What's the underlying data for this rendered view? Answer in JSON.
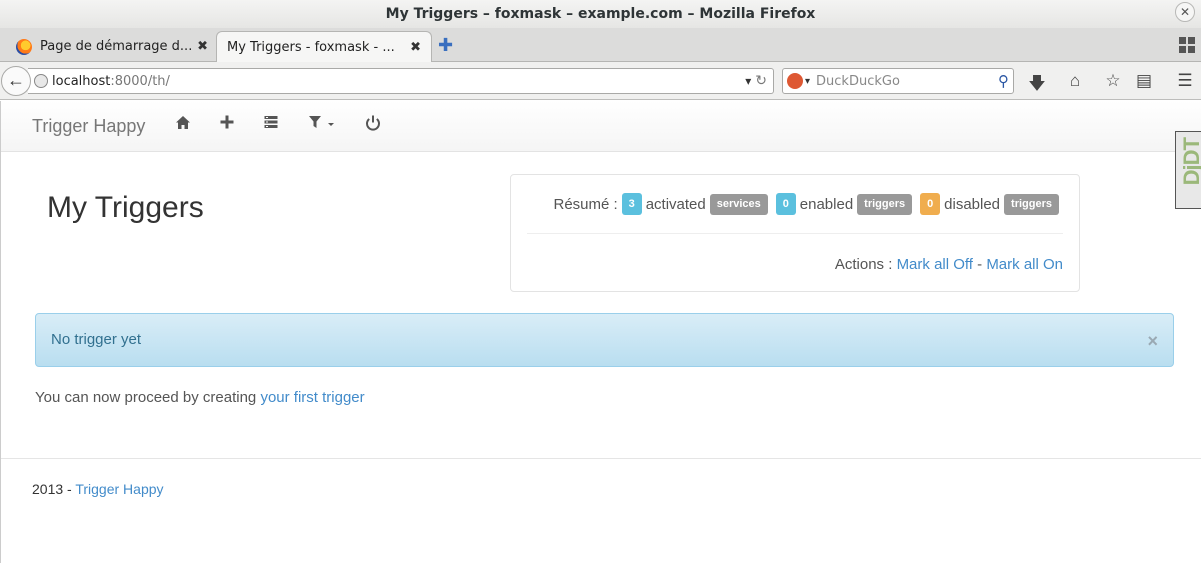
{
  "window": {
    "title": "My Triggers – foxmask – example.com – Mozilla Firefox",
    "close_glyph": "✕"
  },
  "tabs": [
    {
      "label": "Page de démarrage d...",
      "active": false,
      "close": "✖"
    },
    {
      "label": "My Triggers - foxmask - ...",
      "active": true,
      "close": "✖"
    }
  ],
  "new_tab_glyph": "✚",
  "address_bar": {
    "host": "localhost",
    "path": ":8000/th/",
    "dropdown_glyph": "▾",
    "reload_glyph": "↻"
  },
  "search_bar": {
    "placeholder": "DuckDuckGo",
    "engine_dropdown": "▾",
    "search_glyph": "⚲"
  },
  "toolbar_icons": {
    "downloads": "🡇",
    "home": "⌂",
    "bookmark": "☆",
    "reading": "▤",
    "menu": "☰"
  },
  "app": {
    "brand": "Trigger Happy",
    "nav": {
      "filter_caret": "▾"
    },
    "debug_toolbar": "DjDT"
  },
  "main": {
    "heading": "My Triggers",
    "summary": {
      "resume_label": "Résumé :",
      "activated_count": "3",
      "activated_text": "activated",
      "services_label": "services",
      "enabled_count": "0",
      "enabled_text": "enabled",
      "triggers_label_1": "triggers",
      "disabled_count": "0",
      "disabled_text": "disabled",
      "triggers_label_2": "triggers",
      "actions_label": "Actions :",
      "mark_all_off": "Mark all Off",
      "actions_sep": "-",
      "mark_all_on": "Mark all On"
    },
    "alert": {
      "message": "No trigger yet",
      "close": "×"
    },
    "proceed_text": "You can now proceed by creating",
    "first_trigger_link": "your first trigger"
  },
  "footer": {
    "year": "2013 -",
    "link": "Trigger Happy"
  }
}
